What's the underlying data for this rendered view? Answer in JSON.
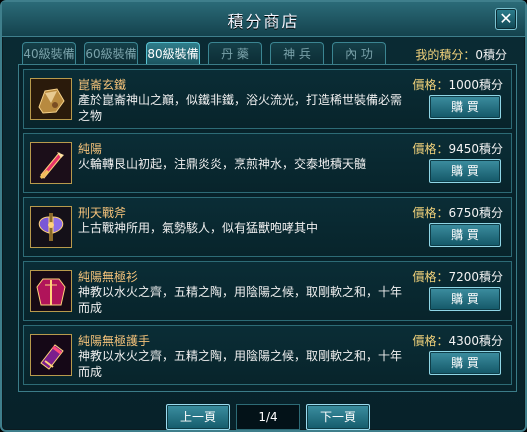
{
  "window": {
    "title": "積分商店",
    "close_symbol": "✕"
  },
  "tabs": [
    {
      "label": "40級裝備",
      "active": false
    },
    {
      "label": "60級裝備",
      "active": false
    },
    {
      "label": "80級裝備",
      "active": true
    },
    {
      "label": "丹 藥",
      "active": false
    },
    {
      "label": "神 兵",
      "active": false
    },
    {
      "label": "內 功",
      "active": false
    }
  ],
  "points": {
    "label": "我的積分：",
    "value": "0積分"
  },
  "items": [
    {
      "name": "崑崙玄鐵",
      "desc": "產於崑崙神山之巔，似鐵非鐵，浴火流光，打造稀世裝備必需之物",
      "price_label": "價格：",
      "price_value": "1000積分",
      "buy_label": "購 買",
      "icon": "ore-icon"
    },
    {
      "name": "純陽",
      "desc": "火輪轉艮山初起，注鼎炎炎，烹煎神水，交泰地積天髓",
      "price_label": "價格：",
      "price_value": "9450積分",
      "buy_label": "購 買",
      "icon": "sword-icon"
    },
    {
      "name": "刑天戰斧",
      "desc": "上古戰神所用，氣勢駭人，似有猛獸咆哮其中",
      "price_label": "價格：",
      "price_value": "6750積分",
      "buy_label": "購 買",
      "icon": "axe-icon"
    },
    {
      "name": "純陽無極衫",
      "desc": "神教以水火之齊，五精之陶，用陰陽之候，取剛軟之和，十年而成",
      "price_label": "價格：",
      "price_value": "7200積分",
      "buy_label": "購 買",
      "icon": "robe-icon"
    },
    {
      "name": "純陽無極護手",
      "desc": "神教以水火之齊，五精之陶，用陰陽之候，取剛軟之和，十年而成",
      "price_label": "價格：",
      "price_value": "4300積分",
      "buy_label": "購 買",
      "icon": "gauntlet-icon"
    }
  ],
  "pager": {
    "prev_label": "上一頁",
    "page_text": "1/4",
    "next_label": "下一頁"
  }
}
